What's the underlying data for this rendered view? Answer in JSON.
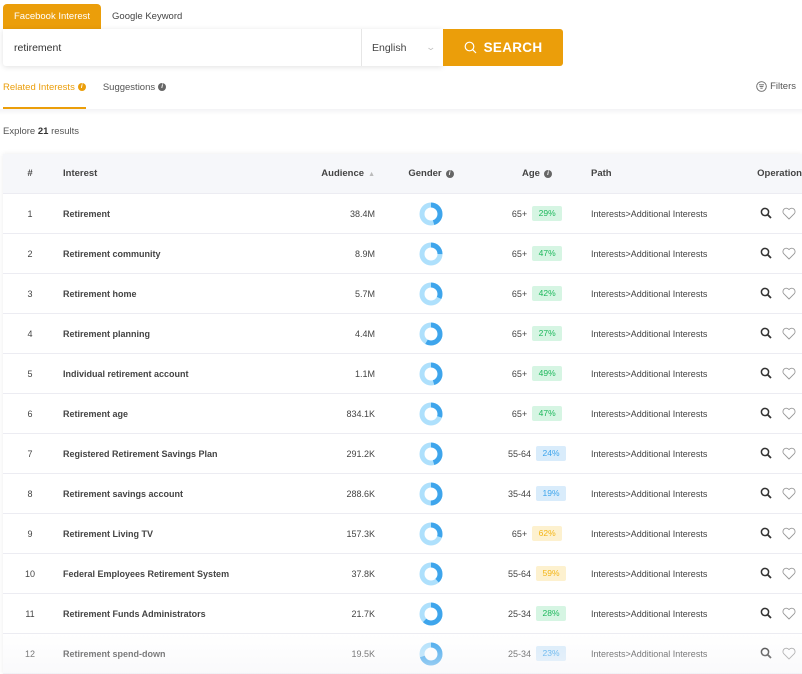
{
  "top_tabs": [
    {
      "label": "Facebook Interest",
      "active": true
    },
    {
      "label": "Google Keyword",
      "active": false
    }
  ],
  "search": {
    "value": "retirement",
    "language": "English",
    "button_label": "SEARCH"
  },
  "sub_tabs": [
    {
      "label": "Related Interests",
      "active": true
    },
    {
      "label": "Suggestions",
      "active": false
    }
  ],
  "filters_label": "Filters",
  "results": {
    "prefix": "Explore",
    "count": "21",
    "suffix": "results"
  },
  "colors": {
    "accent": "#eb9e0a",
    "male": "#3ea5ec",
    "female": "#aee0fc"
  },
  "table": {
    "headers": {
      "num": "#",
      "interest": "Interest",
      "audience": "Audience",
      "gender": "Gender",
      "age": "Age",
      "path": "Path",
      "operation": "Operation"
    },
    "rows": [
      {
        "num": "1",
        "interest": "Retirement",
        "audience": "38.4M",
        "male_share": 0.45,
        "age": "65+",
        "age_pct": "29%",
        "badge": "green",
        "path": "Interests>Additional Interests"
      },
      {
        "num": "2",
        "interest": "Retirement community",
        "audience": "8.9M",
        "male_share": 0.25,
        "age": "65+",
        "age_pct": "47%",
        "badge": "green",
        "path": "Interests>Additional Interests"
      },
      {
        "num": "3",
        "interest": "Retirement home",
        "audience": "5.7M",
        "male_share": 0.32,
        "age": "65+",
        "age_pct": "42%",
        "badge": "green",
        "path": "Interests>Additional Interests"
      },
      {
        "num": "4",
        "interest": "Retirement planning",
        "audience": "4.4M",
        "male_share": 0.58,
        "age": "65+",
        "age_pct": "27%",
        "badge": "green",
        "path": "Interests>Additional Interests"
      },
      {
        "num": "5",
        "interest": "Individual retirement account",
        "audience": "1.1M",
        "male_share": 0.45,
        "age": "65+",
        "age_pct": "49%",
        "badge": "green",
        "path": "Interests>Additional Interests"
      },
      {
        "num": "6",
        "interest": "Retirement age",
        "audience": "834.1K",
        "male_share": 0.3,
        "age": "65+",
        "age_pct": "47%",
        "badge": "green",
        "path": "Interests>Additional Interests"
      },
      {
        "num": "7",
        "interest": "Registered Retirement Savings Plan",
        "audience": "291.2K",
        "male_share": 0.45,
        "age": "55-64",
        "age_pct": "24%",
        "badge": "blue",
        "path": "Interests>Additional Interests"
      },
      {
        "num": "8",
        "interest": "Retirement savings account",
        "audience": "288.6K",
        "male_share": 0.5,
        "age": "35-44",
        "age_pct": "19%",
        "badge": "blue",
        "path": "Interests>Additional Interests"
      },
      {
        "num": "9",
        "interest": "Retirement Living TV",
        "audience": "157.3K",
        "male_share": 0.3,
        "age": "65+",
        "age_pct": "62%",
        "badge": "yellow",
        "path": "Interests>Additional Interests"
      },
      {
        "num": "10",
        "interest": "Federal Employees Retirement System",
        "audience": "37.8K",
        "male_share": 0.38,
        "age": "55-64",
        "age_pct": "59%",
        "badge": "yellow",
        "path": "Interests>Additional Interests"
      },
      {
        "num": "11",
        "interest": "Retirement Funds Administrators",
        "audience": "21.7K",
        "male_share": 0.62,
        "age": "25-34",
        "age_pct": "28%",
        "badge": "green",
        "path": "Interests>Additional Interests"
      },
      {
        "num": "12",
        "interest": "Retirement spend-down",
        "audience": "19.5K",
        "male_share": 0.7,
        "age": "25-34",
        "age_pct": "23%",
        "badge": "blue",
        "path": "Interests>Additional Interests"
      }
    ]
  }
}
